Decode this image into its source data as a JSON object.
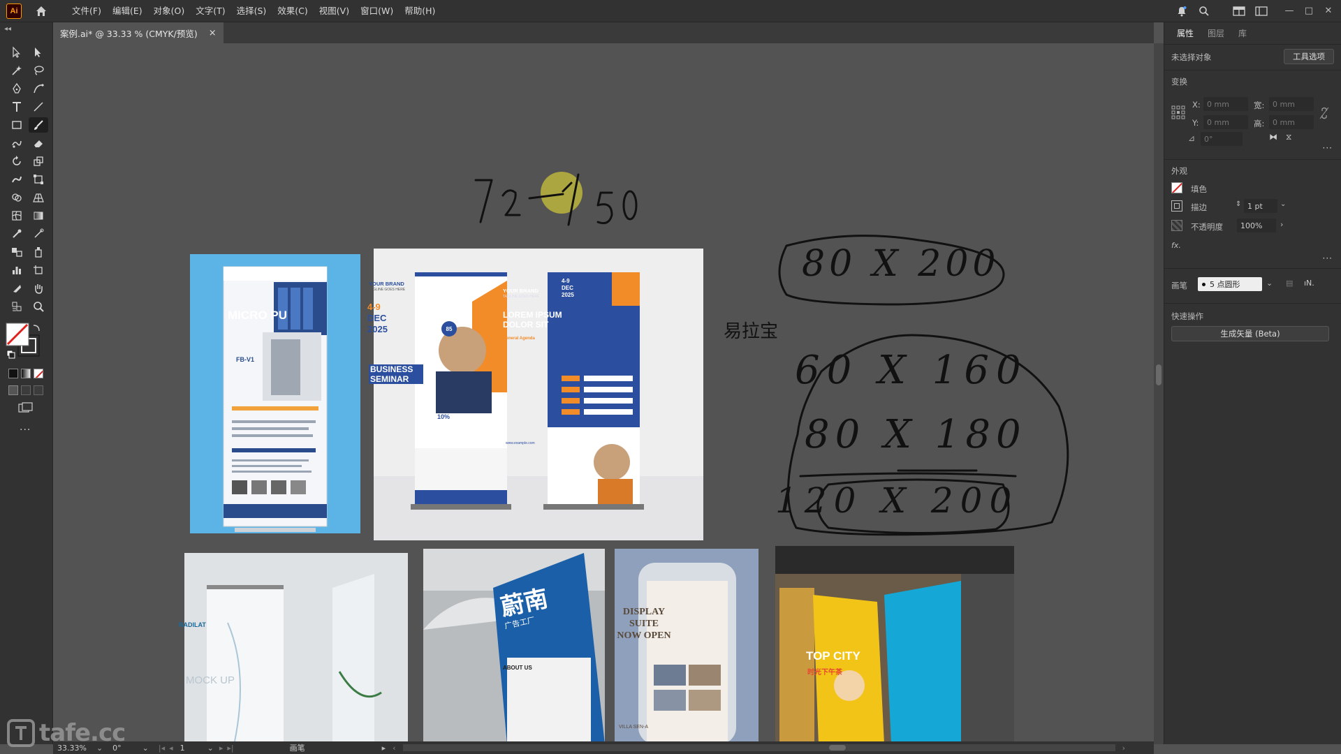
{
  "app": {
    "logo": "Ai"
  },
  "menu": [
    "文件(F)",
    "编辑(E)",
    "对象(O)",
    "文字(T)",
    "选择(S)",
    "效果(C)",
    "视图(V)",
    "窗口(W)",
    "帮助(H)"
  ],
  "tab": {
    "title": "案例.ai* @ 33.33 % (CMYK/预览)",
    "close": "×"
  },
  "panel": {
    "tabs": [
      "属性",
      "图层",
      "库"
    ],
    "no_selection": "未选择对象",
    "tool_options": "工具选项",
    "transform_title": "变换",
    "x_label": "X:",
    "y_label": "Y:",
    "w_label": "宽:",
    "h_label": "高:",
    "x_value": "0 mm",
    "y_value": "0 mm",
    "w_value": "0 mm",
    "h_value": "0 mm",
    "angle_value": "0°",
    "appearance_title": "外观",
    "fill_label": "填色",
    "stroke_label": "描边",
    "stroke_value": "1 pt",
    "opacity_label": "不透明度",
    "opacity_value": "100%",
    "fx_label": "fx.",
    "brush_label": "画笔",
    "brush_value": "5 点圆形",
    "quick_actions_title": "快速操作",
    "generate_vector": "生成矢量 (Beta)"
  },
  "canvas": {
    "handwriting": {
      "top": "72 / 50",
      "oval1": "80 X 200",
      "line1": "60 X 160",
      "line2": "80 X 180",
      "line3": "120 X 200"
    },
    "label_yilabao": "易拉宝",
    "banner1": {
      "title": "MICRO PU",
      "model": "FB-V1"
    },
    "banner2a": {
      "brand": "YOUR BRAND",
      "tagline": "TAGLINE GOES HERE",
      "date_days": "4-9",
      "date_month": "DEC",
      "date_year": "2025",
      "headline": "BUSINESS SEMINAR",
      "percent": "85",
      "discount": "10%"
    },
    "banner2b": {
      "brand": "YOUR BRAND",
      "tagline": "TAGLINE GOES HERE",
      "date_days": "4-9",
      "date_month": "DEC",
      "date_year": "2025",
      "headline": "LOREM IPSUM DOLOR SIT",
      "sub": "General Agenda",
      "url": "www.example.com"
    },
    "photo1": {
      "brand": "RADILAT",
      "mock": "MOCK UP"
    },
    "photo2": {
      "big": "蔚南",
      "small": "广告工厂",
      "about": "ABOUT US"
    },
    "photo3": {
      "line1": "DISPLAY",
      "line2": "SUITE",
      "line3": "NOW OPEN",
      "footer": "VILLA SEN-A"
    },
    "photo4": {
      "title": "TOP CITY",
      "sub": "时光下午茶"
    }
  },
  "status": {
    "zoom": "33.33%",
    "rotate": "0°",
    "artboard": "1",
    "tool": "画笔"
  },
  "watermark": "tafe.cc"
}
